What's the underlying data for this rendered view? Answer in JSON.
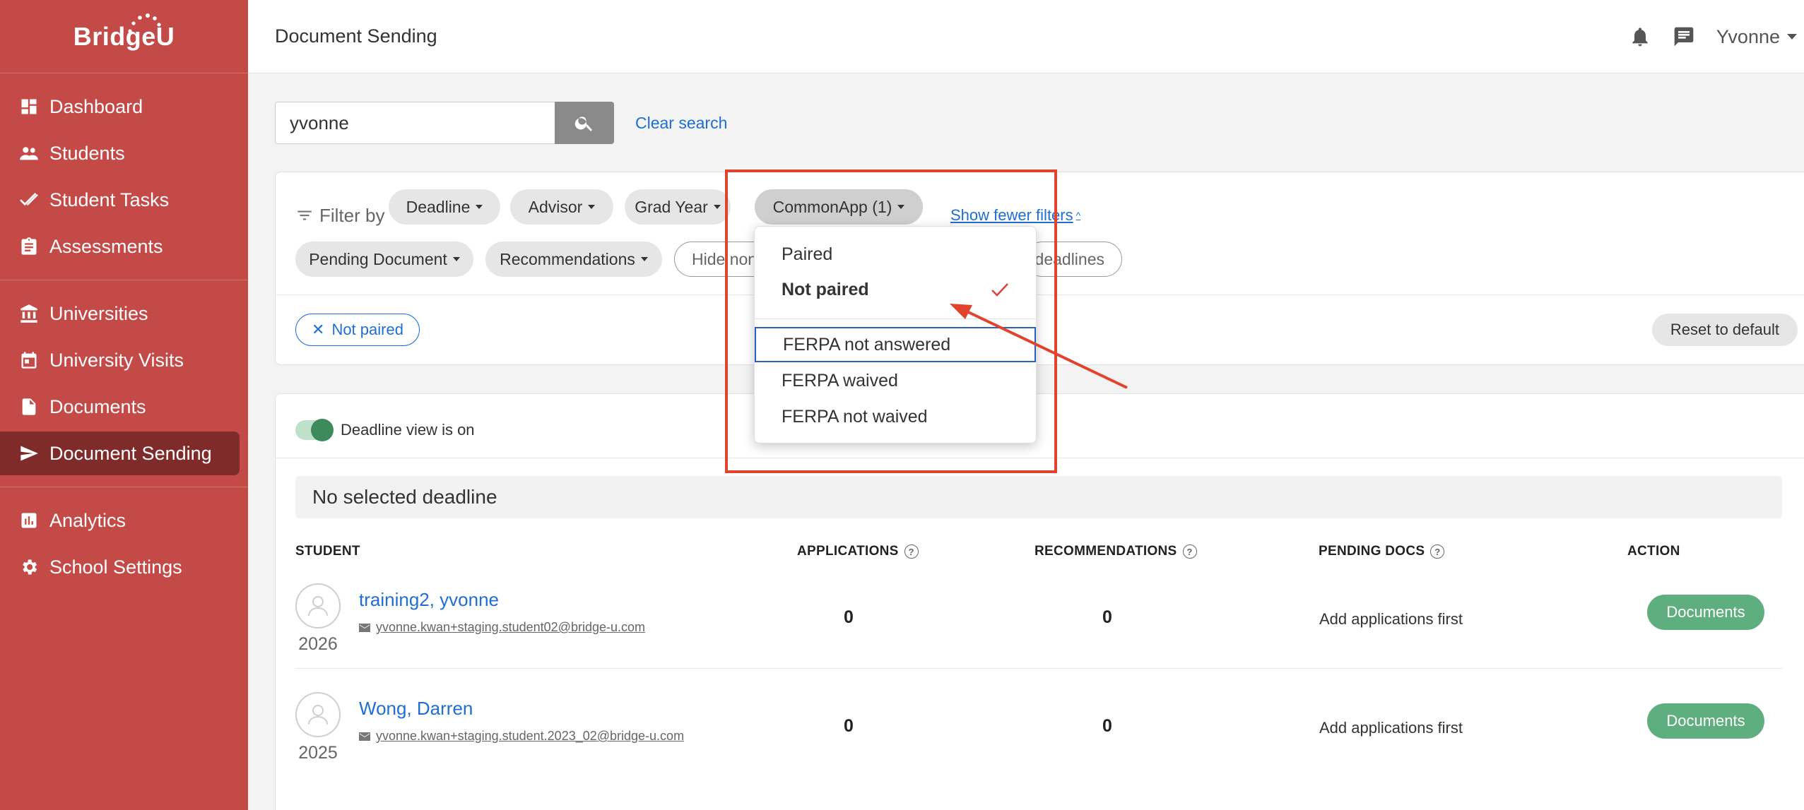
{
  "app": {
    "logo": "BridgeU"
  },
  "sidebar": {
    "groups": [
      {
        "items": [
          {
            "label": "Dashboard",
            "icon": "dashboard-icon"
          },
          {
            "label": "Students",
            "icon": "people-icon"
          },
          {
            "label": "Student Tasks",
            "icon": "double-check-icon"
          },
          {
            "label": "Assessments",
            "icon": "clipboard-icon"
          }
        ]
      },
      {
        "items": [
          {
            "label": "Universities",
            "icon": "institution-icon"
          },
          {
            "label": "University Visits",
            "icon": "calendar-icon"
          },
          {
            "label": "Documents",
            "icon": "document-icon"
          },
          {
            "label": "Document Sending",
            "icon": "send-icon",
            "active": true
          }
        ]
      },
      {
        "items": [
          {
            "label": "Analytics",
            "icon": "bar-chart-icon"
          },
          {
            "label": "School Settings",
            "icon": "gear-icon"
          }
        ]
      }
    ]
  },
  "header": {
    "title": "Document Sending",
    "user": "Yvonne"
  },
  "search": {
    "value": "yvonne",
    "clear_label": "Clear search"
  },
  "filters": {
    "label": "Filter by",
    "chips": [
      "Deadline",
      "Advisor",
      "Grad Year",
      "CommonApp (1)"
    ],
    "show_fewer": "Show fewer filters",
    "row2": [
      "Pending Document",
      "Recommendations"
    ],
    "hide_partial": "Hide non",
    "deadlines_partial": "deadlines",
    "active_filter": "Not paired",
    "reset": "Reset to default"
  },
  "dropdown": {
    "items": [
      "Paired",
      "Not paired",
      "FERPA not answered",
      "FERPA waived",
      "FERPA not waived"
    ],
    "selected": "Not paired",
    "focused": "FERPA not answered"
  },
  "results": {
    "toggle_label": "Deadline view is on",
    "deadline_bar": "No selected deadline",
    "columns": {
      "student": "STUDENT",
      "applications": "APPLICATIONS",
      "recommendations": "RECOMMENDATIONS",
      "pending_docs": "PENDING DOCS",
      "action": "ACTION"
    },
    "rows": [
      {
        "name": "training2, yvonne",
        "email": "yvonne.kwan+staging.student02@bridge-u.com",
        "year": "2026",
        "applications": "0",
        "recommendations": "0",
        "pending": "Add applications first",
        "action": "Documents"
      },
      {
        "name": "Wong, Darren",
        "email": "yvonne.kwan+staging.student.2023_02@bridge-u.com",
        "year": "2025",
        "applications": "0",
        "recommendations": "0",
        "pending": "Add applications first",
        "action": "Documents"
      }
    ]
  },
  "colors": {
    "sidebar": "#c44a47",
    "sidebar_active": "#7e2b2a",
    "link": "#1f6ed4",
    "action_button": "#5fae80",
    "annotation": "#e2432f"
  }
}
